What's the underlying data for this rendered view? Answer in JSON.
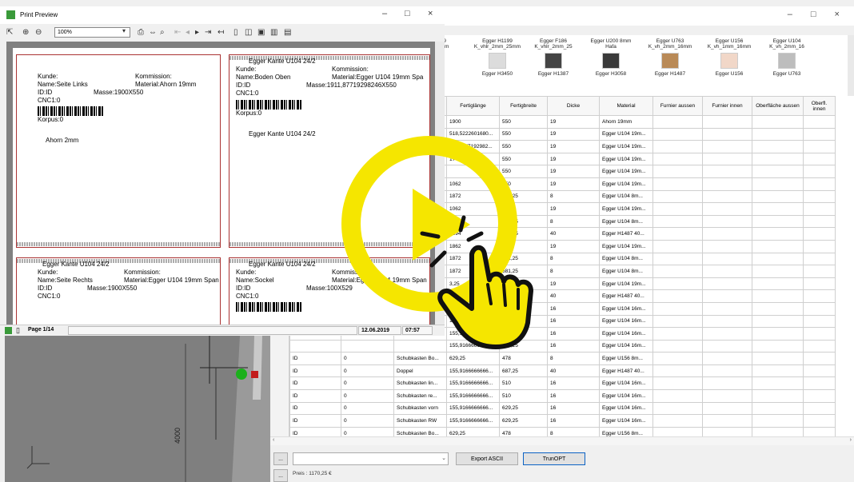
{
  "app": {
    "window_controls": "– □ ×"
  },
  "swatches": [
    {
      "top": "9\nmm",
      "bottom": ""
    },
    {
      "top": "Egger H1199\nK_vhlr_2mm_25mm",
      "bottom": "Egger H3450",
      "color": "#dcdcdc"
    },
    {
      "top": "Egger F186\nK_vhlr_2mm_25",
      "bottom": "Egger H1387",
      "color": "#444444"
    },
    {
      "top": "Egger U200 8mm\nHafa",
      "bottom": "Egger H3058",
      "color": "#3a3a3a"
    },
    {
      "top": "Egger U763\nK_vh_2mm_16mm",
      "bottom": "Egger H1487",
      "color": "#b98a57"
    },
    {
      "top": "Egger U156\nK_vh_1mm_16mm",
      "bottom": "Egger U156",
      "color": "#f1d7c8"
    },
    {
      "top": "Egger U104\nK_vh_2mm_16",
      "bottom": "Egger U763",
      "color": "#bdbdbd"
    }
  ],
  "grid": {
    "columns": [
      "",
      "",
      "",
      "Fertiglänge",
      "Fertigbreite",
      "Dicke",
      "Material",
      "Furnier aussen",
      "Furnier innen",
      "Oberfläche aussen",
      "Oberfl. innen"
    ],
    "rows": [
      [
        "",
        "",
        "",
        "1900",
        "550",
        "19",
        "Ahorn 19mm"
      ],
      [
        "",
        "",
        "",
        "518,5222601680...",
        "550",
        "19",
        "Egger U104 19m..."
      ],
      [
        "",
        "",
        "",
        "1911,877192982...",
        "550",
        "19",
        "Egger U104 19m..."
      ],
      [
        "",
        "",
        "",
        "1742",
        "550",
        "19",
        "Egger U104 19m..."
      ],
      [
        "",
        "",
        "",
        "",
        "550",
        "19",
        "Egger U104 19m..."
      ],
      [
        "",
        "",
        "",
        "1062",
        "550",
        "19",
        "Egger U104 19m..."
      ],
      [
        "",
        "",
        "",
        "1872",
        "681,25",
        "8",
        "Egger U104 8m..."
      ],
      [
        "",
        "",
        "",
        "1062",
        "550",
        "19",
        "Egger U104 19m..."
      ],
      [
        "",
        "",
        "",
        "1872",
        "681,25",
        "8",
        "Egger U104 8m..."
      ],
      [
        "",
        "",
        "",
        "1894",
        "687,25",
        "40",
        "Egger H1487 40..."
      ],
      [
        "",
        "",
        "",
        "1862",
        "550",
        "19",
        "Egger U104 19m..."
      ],
      [
        "",
        "",
        "",
        "1872",
        "681,25",
        "8",
        "Egger U104 8m..."
      ],
      [
        "",
        "",
        "",
        "1872",
        "681,25",
        "8",
        "Egger U104 8m..."
      ],
      [
        "",
        "",
        "",
        "3,25",
        "530",
        "19",
        "Egger U104 19m..."
      ],
      [
        "",
        "",
        "",
        "1155,9166666666...",
        "687,25",
        "40",
        "Egger H1487 40..."
      ],
      [
        "",
        "",
        "",
        "155,9166666666...",
        "510",
        "16",
        "Egger U104 16m..."
      ],
      [
        "",
        "",
        "",
        "155,9166666666...",
        "510",
        "16",
        "Egger U104 16m..."
      ],
      [
        "",
        "",
        "",
        "155,9166666666...",
        "629,25",
        "16",
        "Egger U104 16m..."
      ],
      [
        "",
        "",
        "",
        "155,9166666666...",
        "629,25",
        "16",
        "Egger U104 16m..."
      ],
      [
        "ID",
        "0",
        "Schubkasten Bo...",
        "629,25",
        "478",
        "8",
        "Egger U156 8m..."
      ],
      [
        "ID",
        "0",
        "Doppel",
        "155,9166666666...",
        "687,25",
        "40",
        "Egger H1487 40..."
      ],
      [
        "ID",
        "0",
        "Schubkasten lin...",
        "155,9166666666...",
        "510",
        "16",
        "Egger U104 16m..."
      ],
      [
        "ID",
        "0",
        "Schubkasten re...",
        "155,9166666666...",
        "510",
        "16",
        "Egger U104 16m..."
      ],
      [
        "ID",
        "0",
        "Schubkasten vorn",
        "155,9166666666...",
        "629,25",
        "16",
        "Egger U104 16m..."
      ],
      [
        "ID",
        "0",
        "Schubkasten RW",
        "155,9166666666...",
        "629,25",
        "16",
        "Egger U104 16m..."
      ],
      [
        "ID",
        "0",
        "Schubkasten Bo...",
        "629,25",
        "478",
        "8",
        "Egger U156 8m..."
      ],
      [
        "ID",
        "0",
        "Doppel",
        "155,9166666666...",
        "687,25",
        "40",
        "Egger H1487 40..."
      ]
    ]
  },
  "bottom": {
    "small_btn": "...",
    "export_ascii": "Export ASCII",
    "trunopt": "TrunOPT",
    "preis": "Preis : 1170,25 €"
  },
  "print_preview": {
    "title": "Print Preview",
    "zoom": "100%",
    "status_page": "Page 1/14",
    "status_date": "12.06.2019",
    "status_time": "07:57",
    "labels": [
      {
        "header": "",
        "kunde": "Kunde:",
        "name": "Name:Seite Links",
        "id": "ID:ID",
        "cnc": "CNC1:0",
        "kommission": "Kommission:",
        "material": "Material:Ahorn 19mm",
        "masse": "Masse:1900X550",
        "korpus": "Korpus:0",
        "kante": "Ahorn 2mm"
      },
      {
        "header": "Egger Kante U104 24/2",
        "kunde": "Kunde:",
        "name": "Name:Boden Oben",
        "id": "ID:ID",
        "cnc": "CNC1:0",
        "kommission": "Kommission:",
        "material": "Material:Egger U104 19mm Spa",
        "masse": "Masse:1911,87719298246X550",
        "korpus": "Korpus:0",
        "kante": "Egger Kante U104 24/2"
      },
      {
        "header": "Egger Kante U104 24/2",
        "kunde": "Kunde:",
        "name": "Name:Seite Rechts",
        "id": "ID:ID",
        "cnc": "CNC1:0",
        "kommission": "Kommission:",
        "material": "Material:Egger U104 19mm Span",
        "masse": "Masse:1900X550",
        "korpus": "",
        "kante": ""
      },
      {
        "header": "Egger Kante U104 24/2",
        "kunde": "Kunde:",
        "name": "Name:Sockel",
        "id": "ID:ID",
        "cnc": "CNC1:0",
        "kommission": "Kommission:",
        "material": "Material:Egger U104 19mm Span",
        "masse": "Masse:100X529",
        "korpus": "",
        "kante": ""
      }
    ]
  },
  "viewport": {
    "dimension_text": "4000"
  },
  "overlay": {
    "accent": "#f5e600"
  }
}
